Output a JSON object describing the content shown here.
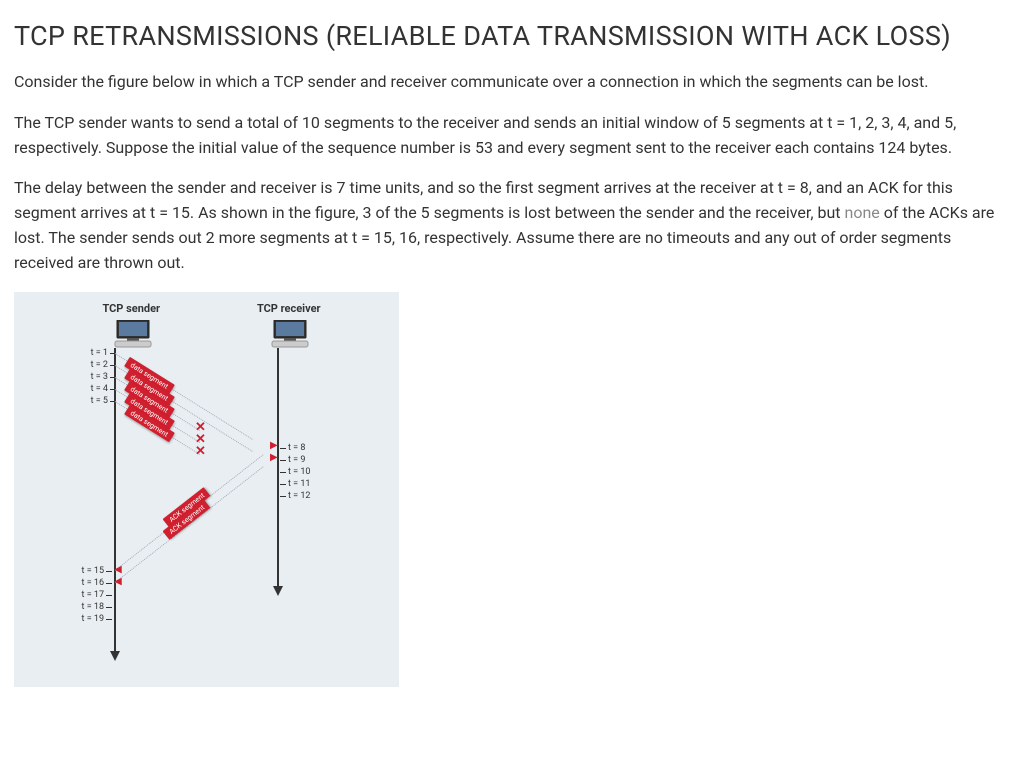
{
  "title": "TCP RETRANSMISSIONS (RELIABLE DATA TRANSMISSION WITH ACK LOSS)",
  "p1": "Consider the figure below in which a TCP sender and receiver communicate over a connection in which the segments can be lost.",
  "p2": "The TCP sender wants to send a total of 10 segments to the receiver and sends an initial window of 5 segments at t = 1, 2, 3, 4, and 5, respectively. Suppose the initial value of the sequence number is 53 and every segment sent to the receiver each contains 124 bytes.",
  "p3a": "The delay between the sender and receiver is 7 time units, and so the first segment arrives at the receiver at t = 8, and an ACK for this segment arrives at t = 15. As shown in the figure, 3 of the 5 segments is lost between the sender and the receiver, but ",
  "p3_none": "none",
  "p3b": " of the ACKs are lost. The sender sends out 2 more segments at t = 15, 16, respectively. Assume there are no timeouts and any out of order segments received are thrown out.",
  "diagram": {
    "senderLabel": "TCP sender",
    "receiverLabel": "TCP receiver",
    "dataSegmentLabel": "data segment",
    "ackSegmentLabel": "ACK segment",
    "senderTicks": [
      {
        "label": "t = 1",
        "offset": 0
      },
      {
        "label": "t = 2",
        "offset": 12
      },
      {
        "label": "t = 3",
        "offset": 24
      },
      {
        "label": "t = 4",
        "offset": 36
      },
      {
        "label": "t = 5",
        "offset": 48
      }
    ],
    "senderTicksLate": [
      {
        "label": "t = 15",
        "offset": 218
      },
      {
        "label": "t = 16",
        "offset": 230
      },
      {
        "label": "t = 17",
        "offset": 242
      },
      {
        "label": "t = 18",
        "offset": 254
      },
      {
        "label": "t = 19",
        "offset": 266
      }
    ],
    "receiverTicks": [
      {
        "label": "t = 8",
        "offset": 95
      },
      {
        "label": "t = 9",
        "offset": 107
      },
      {
        "label": "t = 10",
        "offset": 119
      },
      {
        "label": "t = 11",
        "offset": 131
      },
      {
        "label": "t = 12",
        "offset": 143
      }
    ]
  }
}
